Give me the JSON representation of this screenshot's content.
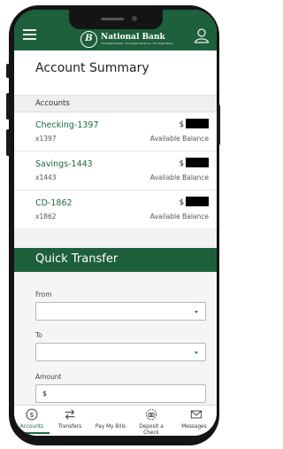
{
  "header": {
    "bank_name": "National Bank",
    "tagline": "The Right People. The Right Solutions. The Right Bank.",
    "logo_initial": "B",
    "menu_icon": "hamburger-menu-icon",
    "profile_icon": "user-profile-icon",
    "background": "#1e5f3c"
  },
  "summary": {
    "title": "Account Summary",
    "section_label": "Accounts",
    "accounts": [
      {
        "name": "Checking-1397",
        "number": "x1397",
        "currency": "$",
        "balance_label": "Available Balance"
      },
      {
        "name": "Savings-1443",
        "number": "x1443",
        "currency": "$",
        "balance_label": "Available Balance"
      },
      {
        "name": "CD-1862",
        "number": "x1862",
        "currency": "$",
        "balance_label": "Available Balance"
      }
    ]
  },
  "transfer": {
    "title": "Quick Transfer",
    "from_label": "From",
    "from_value": "",
    "to_label": "To",
    "to_value": "",
    "amount_label": "Amount",
    "amount_value": "$"
  },
  "tabs": [
    {
      "label": "Accounts",
      "icon": "dollar-circle-icon",
      "active": true
    },
    {
      "label": "Transfers",
      "icon": "transfer-arrows-icon",
      "active": false
    },
    {
      "label": "Pay My Bills",
      "icon": "bills-icon",
      "active": false
    },
    {
      "label": "Deposit a Check",
      "icon": "camera-check-icon",
      "active": false
    },
    {
      "label": "Messages",
      "icon": "envelope-icon",
      "active": false
    }
  ],
  "colors": {
    "brand_green": "#1e5f3c",
    "link_green": "#1e6b3f",
    "accent_blue": "#2a6fb0"
  }
}
